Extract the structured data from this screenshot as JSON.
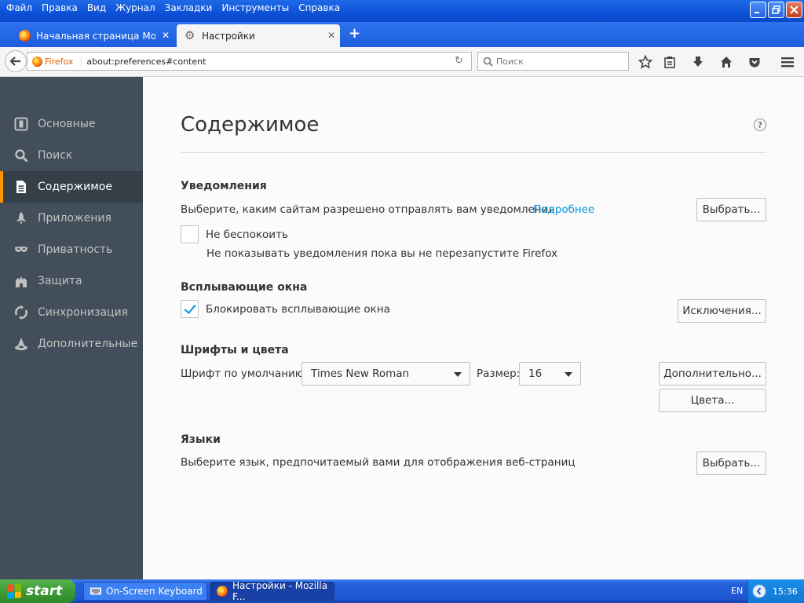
{
  "menubar": [
    "Файл",
    "Правка",
    "Вид",
    "Журнал",
    "Закладки",
    "Инструменты",
    "Справка"
  ],
  "tabs": [
    {
      "title": "Начальная страница Mozilla ...",
      "close": "✕"
    },
    {
      "title": "Настройки",
      "close": "✕"
    }
  ],
  "newtab": "+",
  "navbar": {
    "identity": "Firefox",
    "url": "about:preferences#content",
    "search_placeholder": "Поиск"
  },
  "sidebar": {
    "items": [
      {
        "label": "Основные",
        "icon": "general-icon"
      },
      {
        "label": "Поиск",
        "icon": "search-icon"
      },
      {
        "label": "Содержимое",
        "icon": "content-icon"
      },
      {
        "label": "Приложения",
        "icon": "applications-icon"
      },
      {
        "label": "Приватность",
        "icon": "privacy-icon"
      },
      {
        "label": "Защита",
        "icon": "security-icon"
      },
      {
        "label": "Синхронизация",
        "icon": "sync-icon"
      },
      {
        "label": "Дополнительные",
        "icon": "advanced-icon"
      }
    ],
    "selected_index": 2
  },
  "content": {
    "title": "Содержимое",
    "help": "?",
    "notifications": {
      "heading": "Уведомления",
      "description": "Выберите, каким сайтам разрешено отправлять вам уведомления",
      "learn_more": "Подробнее",
      "choose_button": "Выбрать...",
      "dnd_label": "Не беспокоить",
      "dnd_checked": false,
      "dnd_note": "Не показывать уведомления пока вы не перезапустите Firefox"
    },
    "popups": {
      "heading": "Всплывающие окна",
      "block_label": "Блокировать всплывающие окна",
      "block_checked": true,
      "exceptions_button": "Исключения..."
    },
    "fonts": {
      "heading": "Шрифты и цвета",
      "default_font_label": "Шрифт по умолчанию:",
      "default_font_value": "Times New Roman",
      "size_label": "Размер:",
      "size_value": "16",
      "advanced_button": "Дополнительно...",
      "colors_button": "Цвета..."
    },
    "languages": {
      "heading": "Языки",
      "description": "Выберите язык, предпочитаемый вами для отображения веб-страниц",
      "choose_button": "Выбрать..."
    }
  },
  "taskbar": {
    "start": "start",
    "items": [
      "On-Screen Keyboard",
      "Настройки - Mozilla F..."
    ],
    "lang": "EN",
    "clock": "15:36"
  },
  "colors": {
    "accent": "#0095dd",
    "sidebar_bg": "#424f5a",
    "selected_marker": "#ff9500"
  }
}
